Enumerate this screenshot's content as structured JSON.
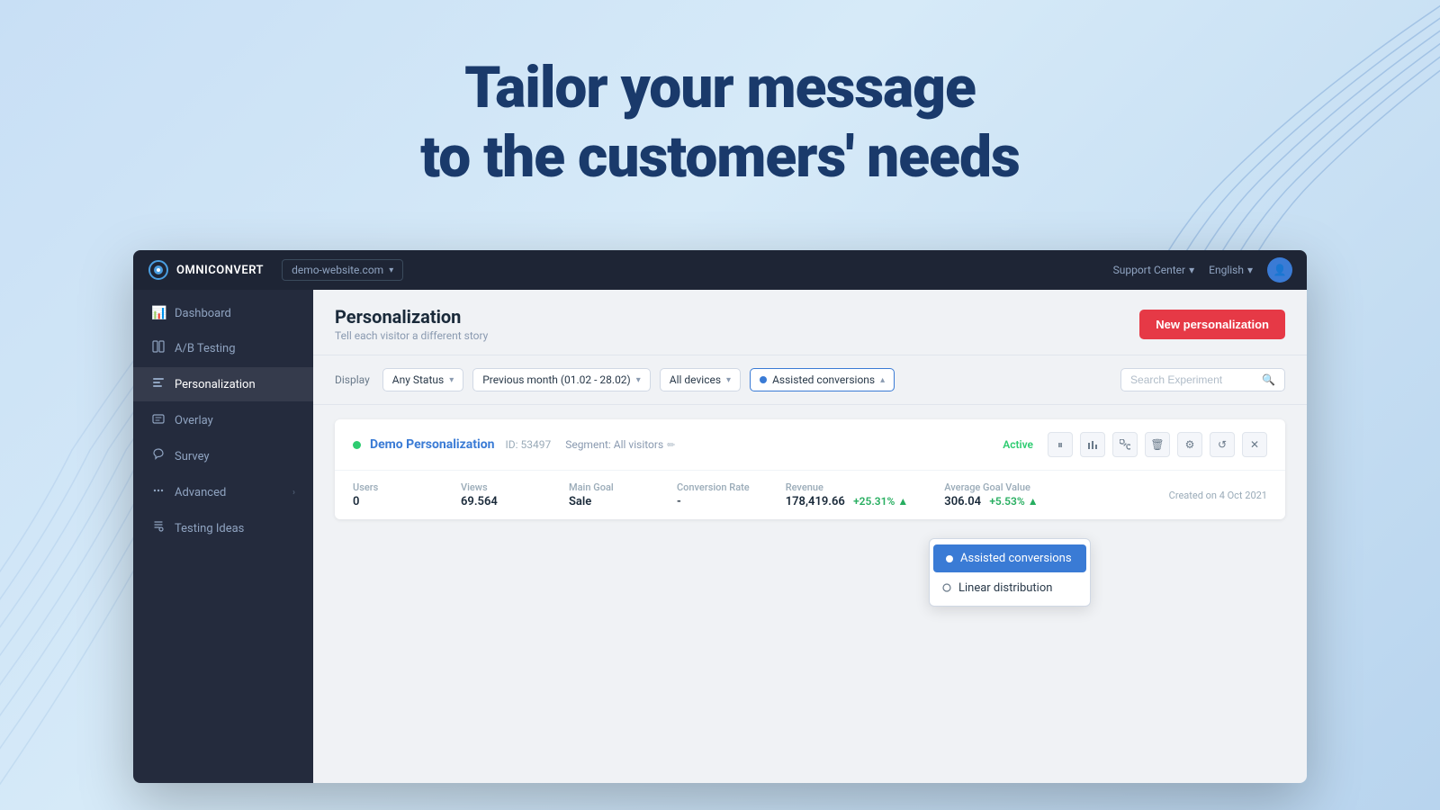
{
  "hero": {
    "line1": "Tailor your message",
    "line2": "to the customers' needs"
  },
  "navbar": {
    "brand": "OMNICONVERT",
    "site": "demo-website.com",
    "support": "Support Center",
    "language": "English",
    "chevron": "▾"
  },
  "sidebar": {
    "items": [
      {
        "id": "dashboard",
        "label": "Dashboard",
        "icon": "📊",
        "active": false
      },
      {
        "id": "ab-testing",
        "label": "A/B Testing",
        "icon": "⊞",
        "active": false
      },
      {
        "id": "personalization",
        "label": "Personalization",
        "icon": "≋",
        "active": true
      },
      {
        "id": "overlay",
        "label": "Overlay",
        "icon": "💬",
        "active": false
      },
      {
        "id": "survey",
        "label": "Survey",
        "icon": "∞",
        "active": false
      },
      {
        "id": "advanced",
        "label": "Advanced",
        "icon": "⋯",
        "active": false,
        "hasSubmenu": true
      },
      {
        "id": "testing-ideas",
        "label": "Testing Ideas",
        "icon": "✎",
        "active": false
      }
    ]
  },
  "page": {
    "title": "Personalization",
    "subtitle": "Tell each visitor a different story",
    "new_button": "New personalization"
  },
  "filters": {
    "display_label": "Display",
    "status": "Any Status",
    "date_range": "Previous month (01.02 - 28.02)",
    "devices": "All devices",
    "metric": "Assisted conversions",
    "search_placeholder": "Search Experiment"
  },
  "dropdown": {
    "items": [
      {
        "id": "assisted",
        "label": "Assisted conversions",
        "selected": true,
        "type": "dot"
      },
      {
        "id": "linear",
        "label": "Linear distribution",
        "selected": false,
        "type": "icon"
      }
    ]
  },
  "experiment": {
    "status": "Active",
    "name": "Demo Personalization",
    "id": "ID: 53497",
    "segment": "Segment: All visitors",
    "created": "Created on 4 Oct 2021",
    "data": {
      "users": {
        "label": "Users",
        "value": "0"
      },
      "views": {
        "label": "Views",
        "value": "69.564"
      },
      "main_goal": {
        "label": "Main Goal",
        "value": "Sale"
      },
      "conversion_rate": {
        "label": "Conversion Rate",
        "value": "-"
      },
      "revenue": {
        "label": "Revenue",
        "value": "178,419.66",
        "badge": "+25.31%",
        "arrow": "▲"
      },
      "avg_goal": {
        "label": "Average Goal Value",
        "value": "306.04",
        "badge": "+5.53%",
        "arrow": "▲"
      }
    },
    "actions": [
      "⏸",
      "⊞",
      "🔗",
      "🗑",
      "⚙",
      "↺",
      "✕"
    ]
  }
}
